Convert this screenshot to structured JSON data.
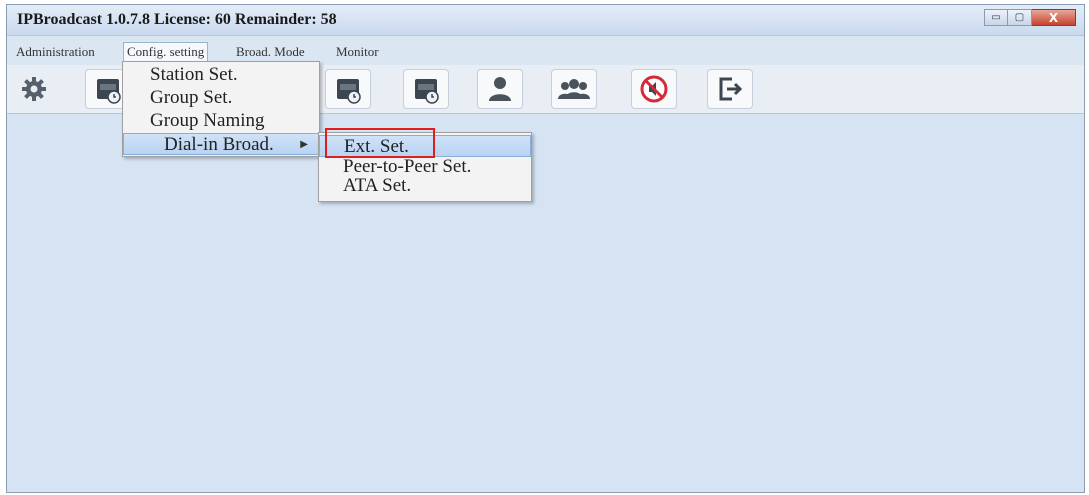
{
  "window": {
    "title": "IPBroadcast 1.0.7.8 License: 60 Remainder: 58",
    "controls": {
      "minimize": "▭",
      "maximize": "▢",
      "close": "X"
    }
  },
  "menubar": {
    "items": [
      "Administration",
      "Config. setting",
      "Broad. Mode",
      "Monitor"
    ],
    "active": "Config. setting"
  },
  "toolbar": {
    "icons": [
      "gear-icon",
      "now-schedule-icon",
      "week-schedule-icon",
      "month-schedule-icon",
      "user-icon",
      "group-users-icon",
      "mute-icon",
      "exit-icon"
    ]
  },
  "config_menu": {
    "items": [
      "Station Set.",
      "Group Set.",
      "Group Naming",
      "Dial-in Broad."
    ],
    "highlighted": "Dial-in Broad."
  },
  "dial_in_submenu": {
    "items": [
      "Ext. Set.",
      "Peer-to-Peer Set.",
      "ATA Set."
    ],
    "highlighted": "Ext. Set."
  },
  "colors": {
    "workarea": "#d6e3f3",
    "highlight_box": "#e02020"
  }
}
